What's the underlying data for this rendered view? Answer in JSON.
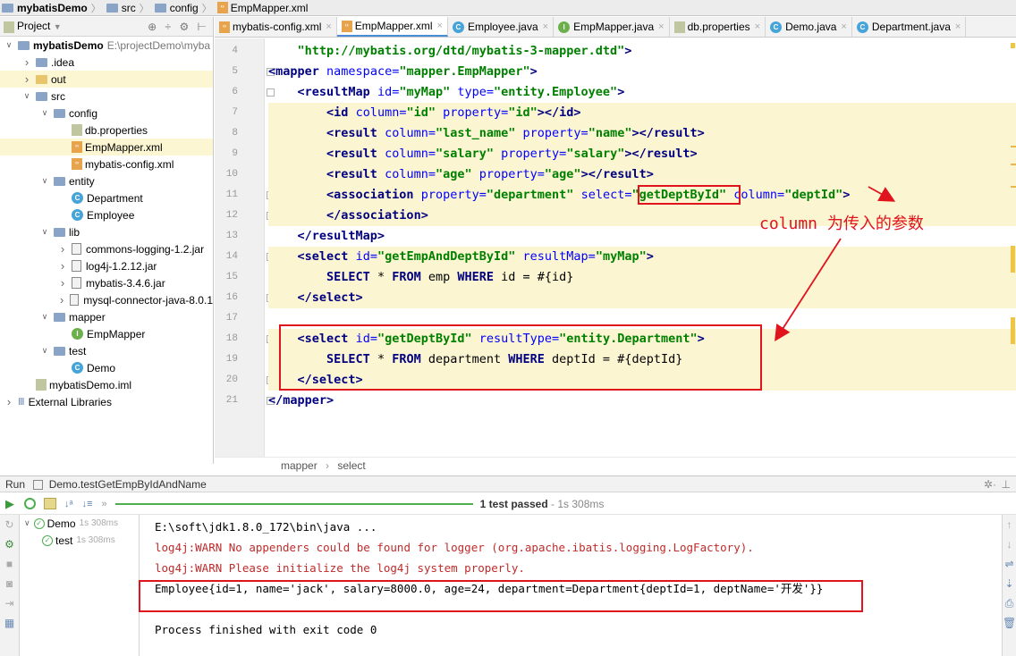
{
  "nav": {
    "crumbs": [
      {
        "label": "mybatisDemo",
        "icon": "project-folder-icon"
      },
      {
        "label": "src",
        "icon": "folder-icon"
      },
      {
        "label": "config",
        "icon": "folder-icon"
      },
      {
        "label": "EmpMapper.xml",
        "icon": "xml-file-icon"
      }
    ]
  },
  "project": {
    "header_label": "Project",
    "tree": [
      {
        "label": "mybatisDemo",
        "extra": "E:\\projectDemo\\myba",
        "depth": 0,
        "arrow": "down",
        "icon": "module",
        "bold": true
      },
      {
        "label": ".idea",
        "depth": 1,
        "arrow": "right",
        "icon": "folder"
      },
      {
        "label": "out",
        "depth": 1,
        "arrow": "right",
        "icon": "folder-yellow",
        "selected": true
      },
      {
        "label": "src",
        "depth": 1,
        "arrow": "down",
        "icon": "folder"
      },
      {
        "label": "config",
        "depth": 2,
        "arrow": "down",
        "icon": "folder"
      },
      {
        "label": "db.properties",
        "depth": 3,
        "icon": "properties"
      },
      {
        "label": "EmpMapper.xml",
        "depth": 3,
        "icon": "xml",
        "selected": true
      },
      {
        "label": "mybatis-config.xml",
        "depth": 3,
        "icon": "xml"
      },
      {
        "label": "entity",
        "depth": 2,
        "arrow": "down",
        "icon": "folder"
      },
      {
        "label": "Department",
        "depth": 3,
        "icon": "class"
      },
      {
        "label": "Employee",
        "depth": 3,
        "icon": "class"
      },
      {
        "label": "lib",
        "depth": 2,
        "arrow": "down",
        "icon": "folder"
      },
      {
        "label": "commons-logging-1.2.jar",
        "depth": 3,
        "arrow": "right",
        "icon": "jar"
      },
      {
        "label": "log4j-1.2.12.jar",
        "depth": 3,
        "arrow": "right",
        "icon": "jar"
      },
      {
        "label": "mybatis-3.4.6.jar",
        "depth": 3,
        "arrow": "right",
        "icon": "jar"
      },
      {
        "label": "mysql-connector-java-8.0.1",
        "depth": 3,
        "arrow": "right",
        "icon": "jar"
      },
      {
        "label": "mapper",
        "depth": 2,
        "arrow": "down",
        "icon": "folder"
      },
      {
        "label": "EmpMapper",
        "depth": 3,
        "icon": "interface"
      },
      {
        "label": "test",
        "depth": 2,
        "arrow": "down",
        "icon": "folder"
      },
      {
        "label": "Demo",
        "depth": 3,
        "icon": "class"
      },
      {
        "label": "mybatisDemo.iml",
        "depth": 1,
        "icon": "iml"
      },
      {
        "label": "External Libraries",
        "depth": 0,
        "arrow": "right",
        "icon": "libs"
      }
    ]
  },
  "tabs": [
    {
      "label": "mybatis-config.xml",
      "icon": "xml",
      "active": false
    },
    {
      "label": "EmpMapper.xml",
      "icon": "xml",
      "active": true
    },
    {
      "label": "Employee.java",
      "icon": "class",
      "active": false
    },
    {
      "label": "EmpMapper.java",
      "icon": "interface",
      "active": false
    },
    {
      "label": "db.properties",
      "icon": "properties",
      "active": false
    },
    {
      "label": "Demo.java",
      "icon": "class",
      "active": false
    },
    {
      "label": "Department.java",
      "icon": "class",
      "active": false
    }
  ],
  "editor": {
    "lines": [
      {
        "n": "4",
        "html": "<span class=\"str\">    \"http://mybatis.org/dtd/mybatis-3-mapper.dtd\"</span><span class=\"tag\">&gt;</span>"
      },
      {
        "n": "5",
        "html": "<span class=\"tag\">&lt;mapper</span> <span class=\"attr\">namespace=</span><span class=\"str\">\"mapper.EmpMapper\"</span><span class=\"tag\">&gt;</span>"
      },
      {
        "n": "6",
        "html": "    <span class=\"tag\">&lt;resultMap</span> <span class=\"attr\">id=</span><span class=\"str\">\"myMap\"</span> <span class=\"attr\">type=</span><span class=\"str\">\"entity.Employee\"</span><span class=\"tag\">&gt;</span>"
      },
      {
        "n": "7",
        "hl": true,
        "html": "        <span class=\"tag\">&lt;id</span> <span class=\"attr\">column=</span><span class=\"str\">\"id\"</span> <span class=\"attr\">property=</span><span class=\"str\">\"id\"</span><span class=\"tag\">&gt;&lt;/id&gt;</span>"
      },
      {
        "n": "8",
        "hl": true,
        "html": "        <span class=\"tag\">&lt;result</span> <span class=\"attr\">column=</span><span class=\"str\">\"last_name\"</span> <span class=\"attr\">property=</span><span class=\"str\">\"name\"</span><span class=\"tag\">&gt;&lt;/result&gt;</span>"
      },
      {
        "n": "9",
        "hl": true,
        "html": "        <span class=\"tag\">&lt;result</span> <span class=\"attr\">column=</span><span class=\"str\">\"salary\"</span> <span class=\"attr\">property=</span><span class=\"str\">\"salary\"</span><span class=\"tag\">&gt;&lt;/result&gt;</span>"
      },
      {
        "n": "10",
        "hl": true,
        "html": "        <span class=\"tag\">&lt;result</span> <span class=\"attr\">column=</span><span class=\"str\">\"age\"</span> <span class=\"attr\">property=</span><span class=\"str\">\"age\"</span><span class=\"tag\">&gt;&lt;/result&gt;</span>"
      },
      {
        "n": "11",
        "hl": true,
        "html": "        <span class=\"tag\">&lt;association</span> <span class=\"attr\">property=</span><span class=\"str\">\"department\"</span> <span class=\"attr\">select=</span><span class=\"str\">\"getDeptById\"</span> <span class=\"attr\">column=</span><span class=\"str\">\"deptId\"</span><span class=\"tag\">&gt;</span>"
      },
      {
        "n": "12",
        "hl": true,
        "html": "        <span class=\"tag\">&lt;/association&gt;</span>"
      },
      {
        "n": "13",
        "html": "    <span class=\"tag\">&lt;/resultMap&gt;</span>"
      },
      {
        "n": "14",
        "hl": true,
        "html": "    <span class=\"tag\">&lt;select</span> <span class=\"attr\">id=</span><span class=\"str\">\"getEmpAndDeptById\"</span> <span class=\"attr\">resultMap=</span><span class=\"str\">\"myMap\"</span><span class=\"tag\">&gt;</span>"
      },
      {
        "n": "15",
        "hl": true,
        "html": "        <span class=\"sqlk\">SELECT</span> * <span class=\"sqlk\">FROM</span> emp <span class=\"sqlk\">WHERE</span> id = #{id}"
      },
      {
        "n": "16",
        "hl": true,
        "html": "    <span class=\"tag\">&lt;/select&gt;</span>"
      },
      {
        "n": "17",
        "html": ""
      },
      {
        "n": "18",
        "hl": true,
        "html": "    <span class=\"tag\">&lt;select</span> <span class=\"attr\">id=</span><span class=\"str\">\"getDeptById\"</span> <span class=\"attr\">resultType=</span><span class=\"str\">\"entity.Department\"</span><span class=\"tag\">&gt;</span>"
      },
      {
        "n": "19",
        "hl": true,
        "html": "        <span class=\"sqlk\">SELECT</span> * <span class=\"sqlk\">FROM</span> department <span class=\"sqlk\">WHERE</span> deptId = #{deptId}"
      },
      {
        "n": "20",
        "hl": true,
        "html": "    <span class=\"tag\">&lt;/select&gt;</span>"
      },
      {
        "n": "21",
        "html": "<span class=\"tag\">&lt;/mapper&gt;</span>"
      }
    ],
    "annotation": "column 为传入的参数"
  },
  "breadcrumb_bottom": {
    "a": "mapper",
    "sep": "›",
    "b": "select"
  },
  "run": {
    "header": "Run",
    "config_name": "Demo.testGetEmpByIdAndName",
    "status": "1 test passed",
    "status_time": "- 1s 308ms",
    "tree": [
      {
        "label": "Demo",
        "time": "1s 308ms",
        "depth": 0
      },
      {
        "label": "test",
        "time": "1s 308ms",
        "depth": 1
      }
    ],
    "console": [
      "E:\\soft\\jdk1.8.0_172\\bin\\java ...",
      "log4j:WARN No appenders could be found for logger (org.apache.ibatis.logging.LogFactory).",
      "log4j:WARN Please initialize the log4j system properly.",
      "Employee{id=1, name='jack', salary=8000.0, age=24, department=Department{deptId=1, deptName='开发'}}",
      "",
      "Process finished with exit code 0"
    ]
  },
  "colors": {
    "accent_red": "#e0141c",
    "pass_green": "#4caf50",
    "tab_underline": "#4a8cd8"
  }
}
